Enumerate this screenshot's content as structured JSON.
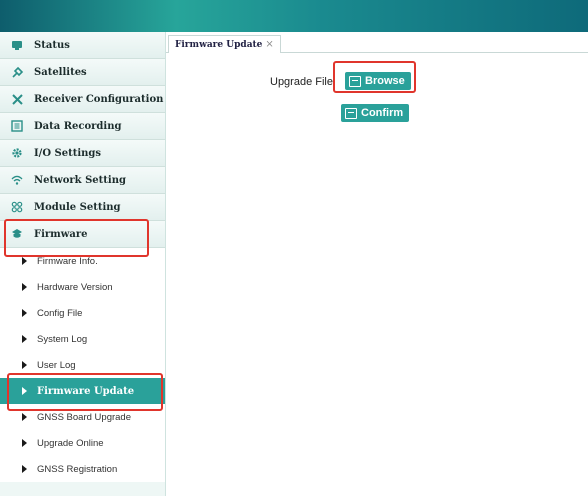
{
  "sidebar": {
    "menu": [
      {
        "label": "Status",
        "icon": "status-icon"
      },
      {
        "label": "Satellites",
        "icon": "satellite-icon"
      },
      {
        "label": "Receiver Configuration",
        "icon": "tools-icon"
      },
      {
        "label": "Data Recording",
        "icon": "data-recording-icon"
      },
      {
        "label": "I/O Settings",
        "icon": "gear-icon"
      },
      {
        "label": "Network Setting",
        "icon": "wifi-icon"
      },
      {
        "label": "Module Setting",
        "icon": "module-icon"
      },
      {
        "label": "Firmware",
        "icon": "firmware-icon"
      }
    ],
    "firmware_items": [
      {
        "label": "Firmware Info."
      },
      {
        "label": "Hardware Version"
      },
      {
        "label": "Config File"
      },
      {
        "label": "System Log"
      },
      {
        "label": "User Log"
      },
      {
        "label": "Firmware Update",
        "active": true
      },
      {
        "label": "GNSS Board Upgrade"
      },
      {
        "label": "Upgrade Online"
      },
      {
        "label": "GNSS Registration"
      }
    ]
  },
  "tab": {
    "label": "Firmware Update",
    "close": "×"
  },
  "main": {
    "upgrade_file_label": "Upgrade File",
    "browse_label": "Browse",
    "confirm_label": "Confirm"
  },
  "colors": {
    "accent": "#2aa19a",
    "highlight": "#e0352c",
    "topbar": "#1a8a8f"
  }
}
